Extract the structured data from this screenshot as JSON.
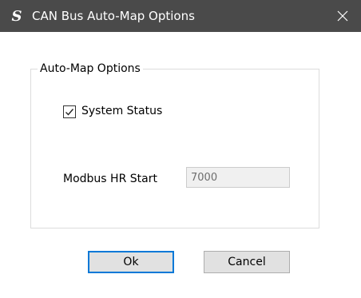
{
  "window": {
    "title": "CAN Bus Auto-Map Options",
    "app_icon": "S",
    "close_icon": "close-icon"
  },
  "group": {
    "legend": "Auto-Map Options"
  },
  "system_status": {
    "label": "System Status",
    "checked": true
  },
  "modbus_hr_start": {
    "label": "Modbus HR Start",
    "value": "7000"
  },
  "buttons": {
    "ok": "Ok",
    "cancel": "Cancel"
  },
  "colors": {
    "titlebar": "#4a4a4a",
    "accent": "#0078d7",
    "button_face": "#e1e1e1",
    "disabled_field": "#f0f0f0"
  }
}
